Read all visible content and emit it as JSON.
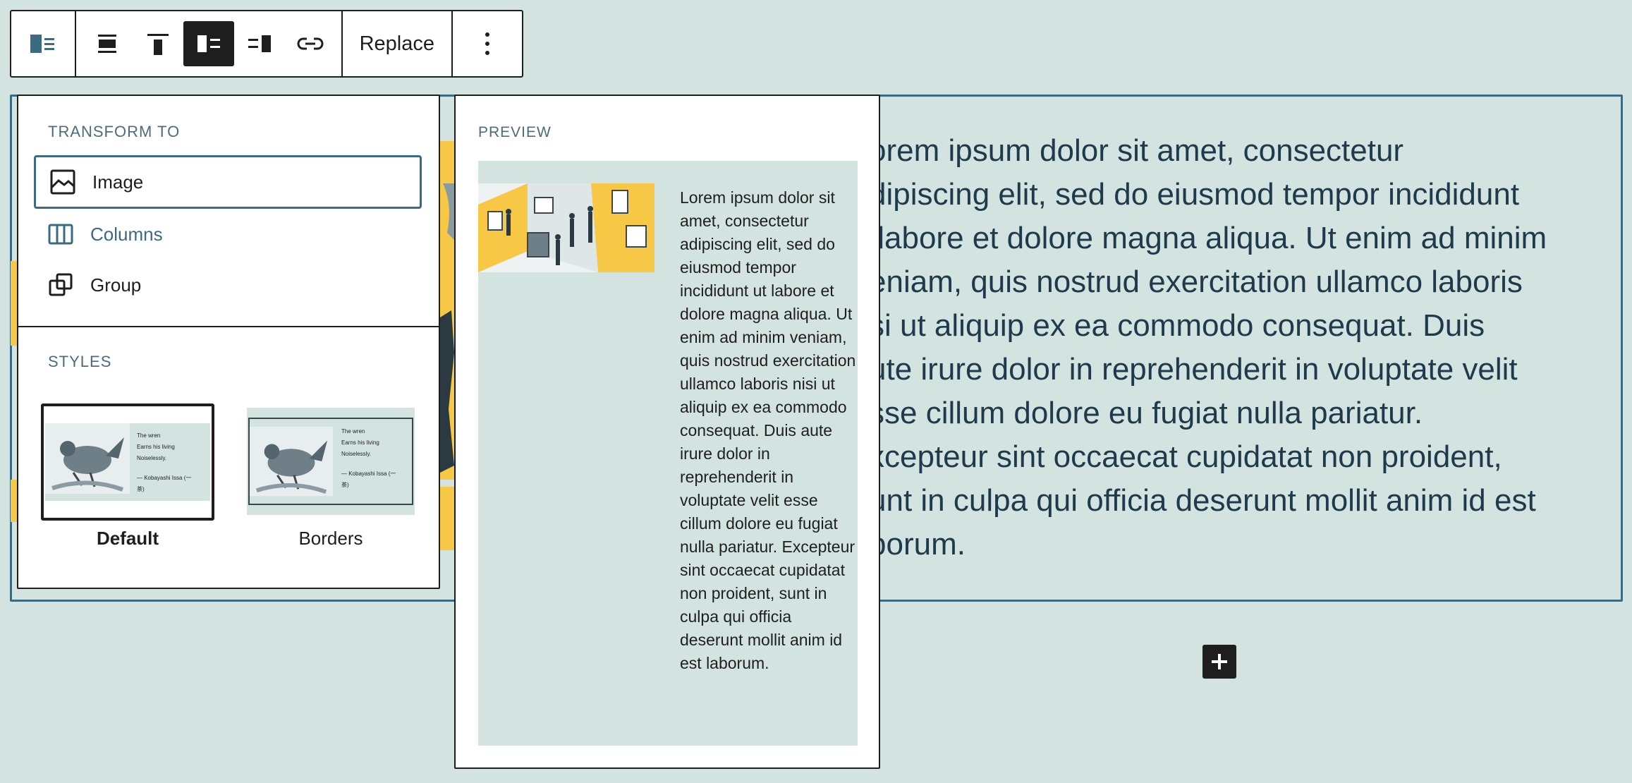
{
  "toolbar": {
    "replace_label": "Replace"
  },
  "popover": {
    "transform_title": "TRANSFORM TO",
    "transform_items": [
      {
        "label": "Image",
        "icon": "image-icon"
      },
      {
        "label": "Columns",
        "icon": "columns-icon"
      },
      {
        "label": "Group",
        "icon": "group-icon"
      }
    ],
    "styles_title": "STYLES",
    "styles": [
      {
        "label": "Default",
        "selected": true
      },
      {
        "label": "Borders",
        "selected": false
      }
    ],
    "style_thumb_text": {
      "line1": "The wren",
      "line2": "Earns his living",
      "line3": "Noiselessly.",
      "attribution_1": "— Kobayashi Issa (一",
      "attribution_2": "茶)"
    }
  },
  "preview": {
    "title": "PREVIEW",
    "text": "Lorem ipsum dolor sit amet, consectetur adipiscing elit, sed do eiusmod tempor incididunt ut labore et dolore magna aliqua. Ut enim ad minim veniam, quis nostrud exercitation ullamco laboris nisi ut aliquip ex ea commodo consequat. Duis aute irure dolor in reprehenderit in voluptate velit esse cillum dolore eu fugiat nulla pariatur. Excepteur sint occaecat cupidatat non proident, sunt in culpa qui officia deserunt mollit anim id est laborum."
  },
  "block": {
    "lines": [
      "orem ipsum dolor sit amet, consectetur",
      "dipiscing elit, sed do eiusmod tempor incididunt",
      " labore et dolore magna aliqua. Ut enim ad minim",
      "eniam, quis nostrud exercitation ullamco laboris",
      "si ut aliquip ex ea commodo consequat. Duis",
      "ute irure dolor in reprehenderit in voluptate velit",
      "sse cillum dolore eu fugiat nulla pariatur.",
      "xcepteur sint occaecat cupidatat non proident,",
      "unt in culpa qui officia deserunt mollit anim id est",
      "borum."
    ]
  },
  "colors": {
    "background": "#d3e4e0",
    "accent": "#3a6b82",
    "dark": "#1e1e1e",
    "yellow": "#f6c846"
  }
}
